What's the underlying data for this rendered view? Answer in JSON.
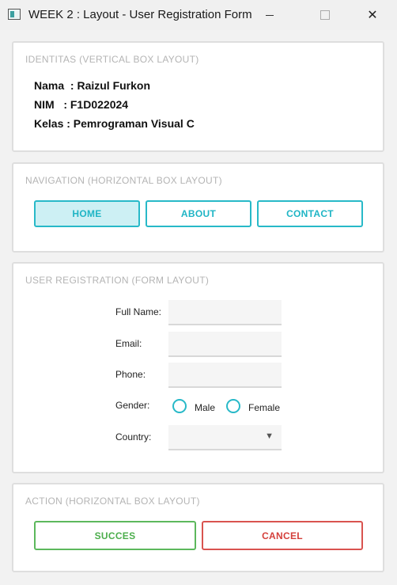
{
  "window": {
    "title": "WEEK 2 : Layout - User Registration Form",
    "minimize_glyph": "",
    "close_glyph": "✕"
  },
  "identity": {
    "group_title": "IDENTITAS (VERTICAL BOX LAYOUT)",
    "nama": "Nama  : Raizul Furkon",
    "nim": "NIM   : F1D022024",
    "kelas": "Kelas : Pemrograman Visual C"
  },
  "navigation": {
    "group_title": "NAVIGATION (HORIZONTAL BOX LAYOUT)",
    "home": "HOME",
    "about": "ABOUT",
    "contact": "CONTACT",
    "active": "HOME"
  },
  "form": {
    "group_title": "USER REGISTRATION (FORM LAYOUT)",
    "full_name_label": "Full Name:",
    "full_name_value": "",
    "email_label": "Email:",
    "email_value": "",
    "phone_label": "Phone:",
    "phone_value": "",
    "gender_label": "Gender:",
    "gender_options": [
      "Male",
      "Female"
    ],
    "gender_selected": null,
    "country_label": "Country:",
    "country_value": "",
    "dropdown_icon": "▼"
  },
  "action": {
    "group_title": "ACTION (HORIZONTAL BOX LAYOUT)",
    "success": "SUCCES",
    "cancel": "CANCEL"
  },
  "colors": {
    "accent": "#28b9c8",
    "active_bg": "#cdf0f4",
    "success": "#5cb85c",
    "cancel": "#d9534f"
  }
}
